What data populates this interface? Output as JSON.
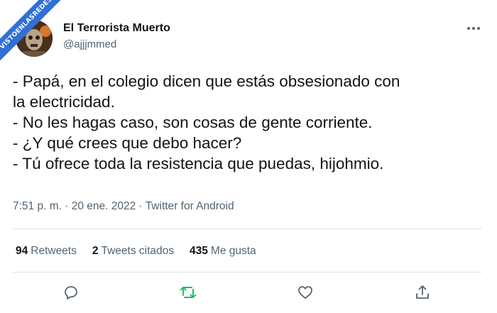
{
  "watermark": {
    "text": "VISTOENLASREDES"
  },
  "tweet": {
    "display_name": "El Terrorista Muerto",
    "handle": "@ajjjmmed",
    "lines": [
      "- Papá, en el colegio dicen que estás obsesionado con",
      "la electricidad.",
      "- No les hagas caso, son cosas de gente corriente.",
      "- ¿Y qué crees que debo hacer?",
      "- Tú ofrece toda la resistencia que puedas, hijohmio."
    ],
    "meta": "7:51 p. m. · 20 ene. 2022 · Twitter for Android"
  },
  "stats": {
    "retweets_count": "94",
    "retweets_label": "Retweets",
    "quotes_count": "2",
    "quotes_label": "Tweets citados",
    "likes_count": "435",
    "likes_label": "Me gusta"
  },
  "icons": {
    "more": "more-horizontal-icon",
    "reply": "reply-icon",
    "retweet": "retweet-icon",
    "like": "heart-icon",
    "share": "share-icon"
  },
  "colors": {
    "banner": "#2f6fd8",
    "retweet": "#17bf63",
    "muted": "#536471",
    "text": "#0f1419"
  }
}
